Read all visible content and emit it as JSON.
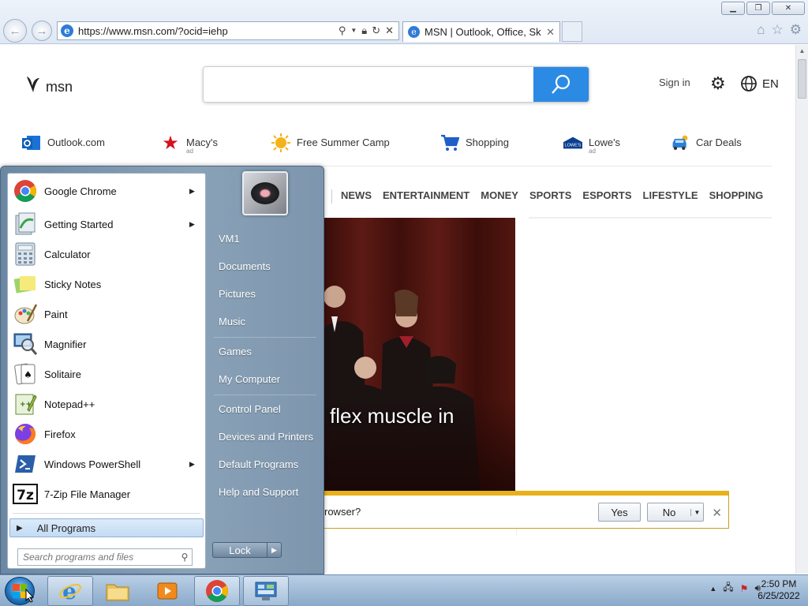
{
  "browser": {
    "url": "https://www.msn.com/?ocid=iehp",
    "tab_title": "MSN | Outlook, Office, Sky...",
    "window_controls": [
      "minimize",
      "restore",
      "close"
    ]
  },
  "msn": {
    "logo_text": "msn",
    "search_placeholder": "",
    "sign_in": "Sign in",
    "language": "EN",
    "quicklinks": [
      {
        "label": "Outlook.com",
        "icon": "outlook-icon",
        "ad": ""
      },
      {
        "label": "Macy's",
        "icon": "macys-star-icon",
        "ad": "ad"
      },
      {
        "label": "Free Summer Camp",
        "icon": "sun-icon",
        "ad": ""
      },
      {
        "label": "Shopping",
        "icon": "cart-icon",
        "ad": ""
      },
      {
        "label": "Lowe's",
        "icon": "lowes-icon",
        "ad": "ad"
      },
      {
        "label": "Car Deals",
        "icon": "car-icon",
        "ad": ""
      }
    ],
    "nav_tabs": [
      "NEWS",
      "ENTERTAINMENT",
      "MONEY",
      "SPORTS",
      "ESPORTS",
      "LIFESTYLE",
      "SHOPPING"
    ],
    "hero_headline": "flex muscle in",
    "prompt_text": "rowser?",
    "prompt_yes": "Yes",
    "prompt_no": "No"
  },
  "start_menu": {
    "programs": [
      {
        "label": "Google Chrome",
        "icon": "chrome-icon",
        "submenu": true
      },
      {
        "label": "Getting Started",
        "icon": "getting-started-icon",
        "submenu": true
      },
      {
        "label": "Calculator",
        "icon": "calculator-icon",
        "submenu": false
      },
      {
        "label": "Sticky Notes",
        "icon": "sticky-notes-icon",
        "submenu": false
      },
      {
        "label": "Paint",
        "icon": "paint-icon",
        "submenu": false
      },
      {
        "label": "Magnifier",
        "icon": "magnifier-icon",
        "submenu": false
      },
      {
        "label": "Solitaire",
        "icon": "solitaire-icon",
        "submenu": false
      },
      {
        "label": "Notepad++",
        "icon": "notepadpp-icon",
        "submenu": false
      },
      {
        "label": "Firefox",
        "icon": "firefox-icon",
        "submenu": false
      },
      {
        "label": "Windows PowerShell",
        "icon": "powershell-icon",
        "submenu": true
      },
      {
        "label": "7-Zip File Manager",
        "icon": "7zip-icon",
        "submenu": false
      }
    ],
    "all_programs": "All Programs",
    "search_placeholder": "Search programs and files",
    "right_items": [
      "VM1",
      "Documents",
      "Pictures",
      "Music",
      "Games",
      "My Computer",
      "Control Panel",
      "Devices and Printers",
      "Default Programs",
      "Help and Support"
    ],
    "lock_label": "Lock"
  },
  "taskbar": {
    "pinned": [
      "internet-explorer-icon",
      "file-explorer-icon",
      "media-player-icon",
      "chrome-icon",
      "control-panel-icon"
    ],
    "time": "2:50 PM",
    "date": "6/25/2022"
  },
  "colors": {
    "msn_search_button": "#2b8ae4",
    "prompt_bar_accent": "#e8b119",
    "start_menu_right": "#7d96ad"
  }
}
